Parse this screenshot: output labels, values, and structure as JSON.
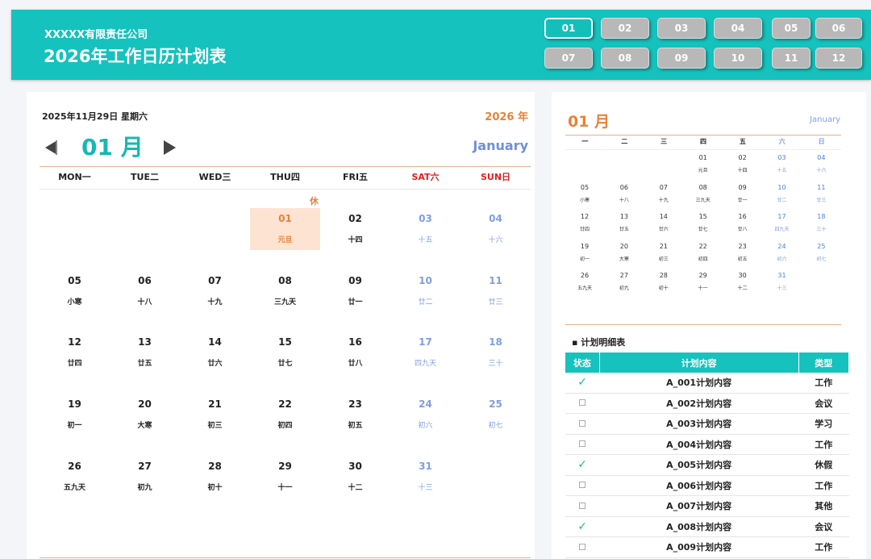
{
  "header": {
    "company": "XXXXX有限责任公司",
    "title": "2026年工作日历计划表",
    "months": [
      "01",
      "02",
      "03",
      "04",
      "05",
      "06",
      "07",
      "08",
      "09",
      "10",
      "11",
      "12"
    ],
    "active_month": "01"
  },
  "calendar": {
    "today": "2025年11月29日   星期六",
    "year_label": "2026 年",
    "month_label": "01 月",
    "month_en": "January",
    "weekdays": [
      "MON一",
      "TUE二",
      "WED三",
      "THU四",
      "FRI五",
      "SAT六",
      "SUN日"
    ],
    "rest_tag": "休",
    "days": [
      {
        "d": "01",
        "l": "元旦",
        "holiday": true
      },
      {
        "d": "02",
        "l": "十四"
      },
      {
        "d": "03",
        "l": "十五"
      },
      {
        "d": "04",
        "l": "十六"
      },
      {
        "d": "05",
        "l": "小寒"
      },
      {
        "d": "06",
        "l": "十八"
      },
      {
        "d": "07",
        "l": "十九"
      },
      {
        "d": "08",
        "l": "三九天"
      },
      {
        "d": "09",
        "l": "廿一"
      },
      {
        "d": "10",
        "l": "廿二"
      },
      {
        "d": "11",
        "l": "廿三"
      },
      {
        "d": "12",
        "l": "廿四"
      },
      {
        "d": "13",
        "l": "廿五"
      },
      {
        "d": "14",
        "l": "廿六"
      },
      {
        "d": "15",
        "l": "廿七"
      },
      {
        "d": "16",
        "l": "廿八"
      },
      {
        "d": "17",
        "l": "四九天"
      },
      {
        "d": "18",
        "l": "三十"
      },
      {
        "d": "19",
        "l": "初一"
      },
      {
        "d": "20",
        "l": "大寒"
      },
      {
        "d": "21",
        "l": "初三"
      },
      {
        "d": "22",
        "l": "初四"
      },
      {
        "d": "23",
        "l": "初五"
      },
      {
        "d": "24",
        "l": "初六"
      },
      {
        "d": "25",
        "l": "初七"
      },
      {
        "d": "26",
        "l": "五九天"
      },
      {
        "d": "27",
        "l": "初九"
      },
      {
        "d": "28",
        "l": "初十"
      },
      {
        "d": "29",
        "l": "十一"
      },
      {
        "d": "30",
        "l": "十二"
      },
      {
        "d": "31",
        "l": "十三"
      }
    ]
  },
  "mini": {
    "month_label": "01 月",
    "month_en": "January",
    "weekdays": [
      "一",
      "二",
      "三",
      "四",
      "五",
      "六",
      "日"
    ],
    "days": [
      {
        "d": "01",
        "l": "元旦"
      },
      {
        "d": "02",
        "l": "十四"
      },
      {
        "d": "03",
        "l": "十五"
      },
      {
        "d": "04",
        "l": "十六"
      },
      {
        "d": "05",
        "l": "小寒"
      },
      {
        "d": "06",
        "l": "十八"
      },
      {
        "d": "07",
        "l": "十九"
      },
      {
        "d": "08",
        "l": "三九天"
      },
      {
        "d": "09",
        "l": "廿一"
      },
      {
        "d": "10",
        "l": "廿二"
      },
      {
        "d": "11",
        "l": "廿三"
      },
      {
        "d": "12",
        "l": "廿四"
      },
      {
        "d": "13",
        "l": "廿五"
      },
      {
        "d": "14",
        "l": "廿六"
      },
      {
        "d": "15",
        "l": "廿七"
      },
      {
        "d": "16",
        "l": "廿八"
      },
      {
        "d": "17",
        "l": "四九天"
      },
      {
        "d": "18",
        "l": "三十"
      },
      {
        "d": "19",
        "l": "初一"
      },
      {
        "d": "20",
        "l": "大寒"
      },
      {
        "d": "21",
        "l": "初三"
      },
      {
        "d": "22",
        "l": "初四"
      },
      {
        "d": "23",
        "l": "初五"
      },
      {
        "d": "24",
        "l": "初六"
      },
      {
        "d": "25",
        "l": "初七"
      },
      {
        "d": "26",
        "l": "五九天"
      },
      {
        "d": "27",
        "l": "初九"
      },
      {
        "d": "28",
        "l": "初十"
      },
      {
        "d": "29",
        "l": "十一"
      },
      {
        "d": "30",
        "l": "十二"
      },
      {
        "d": "31",
        "l": "十三"
      }
    ]
  },
  "plan": {
    "title": "▪ 计划明细表",
    "columns": [
      "状态",
      "计划内容",
      "类型"
    ],
    "check_mark": "✓",
    "rows": [
      {
        "done": true,
        "content": "A_001计划内容",
        "type": "工作"
      },
      {
        "done": false,
        "content": "A_002计划内容",
        "type": "会议"
      },
      {
        "done": false,
        "content": "A_003计划内容",
        "type": "学习"
      },
      {
        "done": false,
        "content": "A_004计划内容",
        "type": "工作"
      },
      {
        "done": true,
        "content": "A_005计划内容",
        "type": "休假"
      },
      {
        "done": false,
        "content": "A_006计划内容",
        "type": "工作"
      },
      {
        "done": false,
        "content": "A_007计划内容",
        "type": "其他"
      },
      {
        "done": true,
        "content": "A_008计划内容",
        "type": "会议"
      },
      {
        "done": false,
        "content": "A_009计划内容",
        "type": "工作"
      }
    ]
  },
  "colors": {
    "accent": "#15c2bd",
    "orange": "#e8823a",
    "weekend": "#7f9ee0",
    "sunday_red": "#e02020"
  }
}
